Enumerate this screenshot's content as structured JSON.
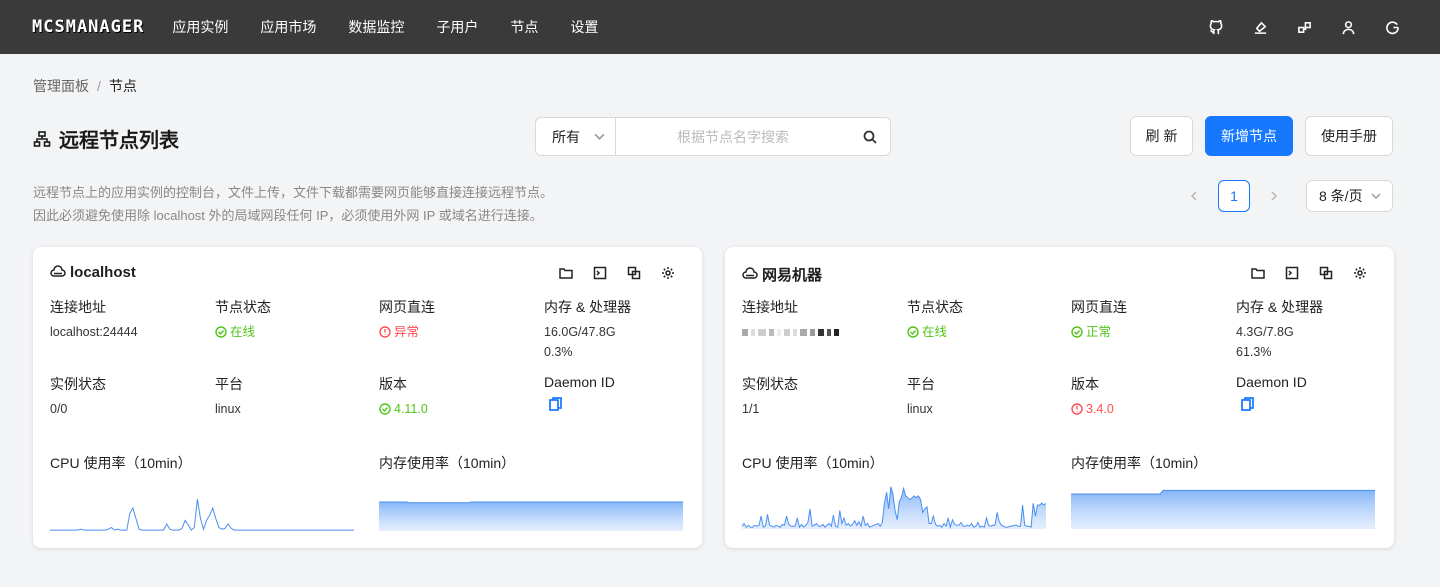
{
  "app": {
    "logo": "MCSMANAGER",
    "nav": [
      "应用实例",
      "应用市场",
      "数据监控",
      "子用户",
      "节点",
      "设置"
    ]
  },
  "breadcrumb": {
    "root": "管理面板",
    "sep": "/",
    "current": "节点"
  },
  "page": {
    "title": "远程节点列表",
    "filter_value": "所有",
    "search_placeholder": "根据节点名字搜索",
    "refresh_label": "刷新",
    "add_label": "新增节点",
    "manual_label": "使用手册",
    "desc_line1": "远程节点上的应用实例的控制台，文件上传，文件下载都需要网页能够直接连接远程节点。",
    "desc_line2": "因此必须避免使用除 localhost 外的局域网段任何 IP，必须使用外网 IP 或域名进行连接。",
    "current_page": "1",
    "page_size": "8 条/页"
  },
  "labels": {
    "address": "连接地址",
    "node_status": "节点状态",
    "web_direct": "网页直连",
    "mem_cpu": "内存 & 处理器",
    "instance_status": "实例状态",
    "platform": "平台",
    "version": "版本",
    "daemon_id": "Daemon ID",
    "cpu_chart": "CPU 使用率（10min）",
    "mem_chart": "内存使用率（10min）"
  },
  "nodes": [
    {
      "name": "localhost",
      "address": "localhost:24444",
      "node_status": "在线",
      "web_direct": "异常",
      "memory": "16.0G/47.8G",
      "cpu": "0.3%",
      "instances": "0/0",
      "platform": "linux",
      "version": "4.11.0"
    },
    {
      "name": "网易机器",
      "address": "",
      "node_status": "在线",
      "web_direct": "正常",
      "memory": "4.3G/7.8G",
      "cpu": "61.3%",
      "instances": "1/1",
      "platform": "linux",
      "version": "3.4.0"
    }
  ],
  "colors": {
    "accent": "#1677ff",
    "ok": "#52c41a",
    "error": "#ff4d4f",
    "topbar": "#3a3a3a"
  },
  "chart_data": [
    {
      "type": "line",
      "title": "CPU 使用率（10min）",
      "series": [
        {
          "values": [
            1,
            1,
            1,
            1,
            1,
            1,
            1,
            1,
            1,
            1,
            2,
            1,
            1,
            1,
            1,
            1,
            1,
            1,
            1,
            2,
            4,
            1,
            2,
            1,
            1,
            1,
            20,
            26,
            14,
            2,
            1,
            1,
            1,
            1,
            1,
            1,
            1,
            1,
            8,
            2,
            1,
            1,
            1,
            3,
            12,
            7,
            1,
            4,
            36,
            14,
            2,
            12,
            18,
            26,
            14,
            4,
            2,
            3,
            8,
            3,
            1,
            1,
            1,
            1,
            1,
            1,
            1,
            1,
            1,
            1,
            1,
            1,
            1,
            1,
            1,
            1,
            1,
            1,
            1,
            1,
            1,
            1,
            1,
            1,
            1,
            1,
            1,
            1,
            1,
            1,
            1,
            1,
            1,
            1,
            1,
            1,
            1,
            1,
            1,
            1
          ]
        }
      ]
    },
    {
      "type": "area",
      "title": "内存使用率（10min）",
      "series": [
        {
          "values": [
            33,
            33,
            33,
            33,
            33,
            33,
            33,
            33,
            33,
            33,
            32,
            32,
            32,
            32,
            32,
            32,
            32,
            32,
            32,
            32,
            32,
            32,
            32,
            32,
            32,
            32,
            32,
            32,
            32,
            32,
            33,
            33,
            33,
            33,
            33,
            33,
            33,
            33,
            33,
            33,
            33,
            33,
            33,
            33,
            33,
            33,
            33,
            33,
            33,
            33,
            33,
            33,
            33,
            33,
            33,
            33,
            33,
            33,
            33,
            33,
            33,
            33,
            33,
            33,
            33,
            33,
            33,
            33,
            33,
            33,
            33,
            33,
            33,
            33,
            33,
            33,
            33,
            33,
            33,
            33,
            33,
            33,
            33,
            33,
            33,
            33,
            33,
            33,
            33,
            33,
            33,
            33,
            33,
            33,
            33,
            33,
            33,
            33,
            33,
            33
          ]
        }
      ]
    },
    {
      "type": "area",
      "title": "CPU 使用率（10min）",
      "series": [
        {
          "values": [
            3,
            6,
            2,
            4,
            2,
            2,
            4,
            3,
            4,
            14,
            2,
            3,
            16,
            4,
            3,
            2,
            4,
            3,
            2,
            5,
            4,
            14,
            5,
            3,
            3,
            3,
            12,
            2,
            5,
            2,
            4,
            7,
            22,
            3,
            4,
            6,
            3,
            3,
            5,
            2,
            4,
            6,
            3,
            15,
            3,
            2,
            20,
            6,
            12,
            4,
            6,
            3,
            5,
            9,
            4,
            8,
            3,
            14,
            4,
            6,
            2,
            3,
            4,
            5,
            6,
            3,
            7,
            28,
            40,
            22,
            46,
            38,
            20,
            10,
            30,
            34,
            44,
            36,
            34,
            32,
            34,
            36,
            34,
            36,
            32,
            18,
            22,
            24,
            6,
            6,
            14,
            5,
            3,
            4,
            2,
            6,
            3,
            12,
            2,
            10,
            5,
            4,
            4,
            7,
            3,
            3,
            4,
            3,
            6,
            2,
            3,
            7,
            2,
            3,
            2,
            12,
            4,
            3,
            4,
            4,
            18,
            8,
            4,
            3,
            2,
            2,
            3,
            3,
            4,
            4,
            3,
            3,
            26,
            4,
            3,
            3,
            2,
            28,
            14,
            26,
            26,
            28,
            26,
            28
          ]
        }
      ]
    },
    {
      "type": "area",
      "title": "内存使用率（10min）",
      "series": [
        {
          "values": [
            38,
            38,
            38,
            38,
            38,
            38,
            38,
            38,
            38,
            38,
            38,
            38,
            38,
            38,
            38,
            38,
            38,
            38,
            38,
            38,
            38,
            38,
            38,
            38,
            38,
            38,
            38,
            38,
            38,
            38,
            42,
            42,
            42,
            42,
            42,
            42,
            42,
            42,
            42,
            42,
            42,
            42,
            42,
            42,
            42,
            42,
            42,
            42,
            42,
            42,
            42,
            42,
            42,
            42,
            42,
            42,
            42,
            42,
            42,
            42,
            42,
            42,
            42,
            42,
            42,
            42,
            42,
            42,
            42,
            42,
            42,
            42,
            42,
            42,
            42,
            42,
            42,
            42,
            42,
            42,
            42,
            42,
            42,
            42,
            42,
            42,
            42,
            42,
            42,
            42,
            42,
            42,
            42,
            42,
            42,
            42,
            42,
            42,
            42,
            42
          ]
        }
      ]
    }
  ]
}
